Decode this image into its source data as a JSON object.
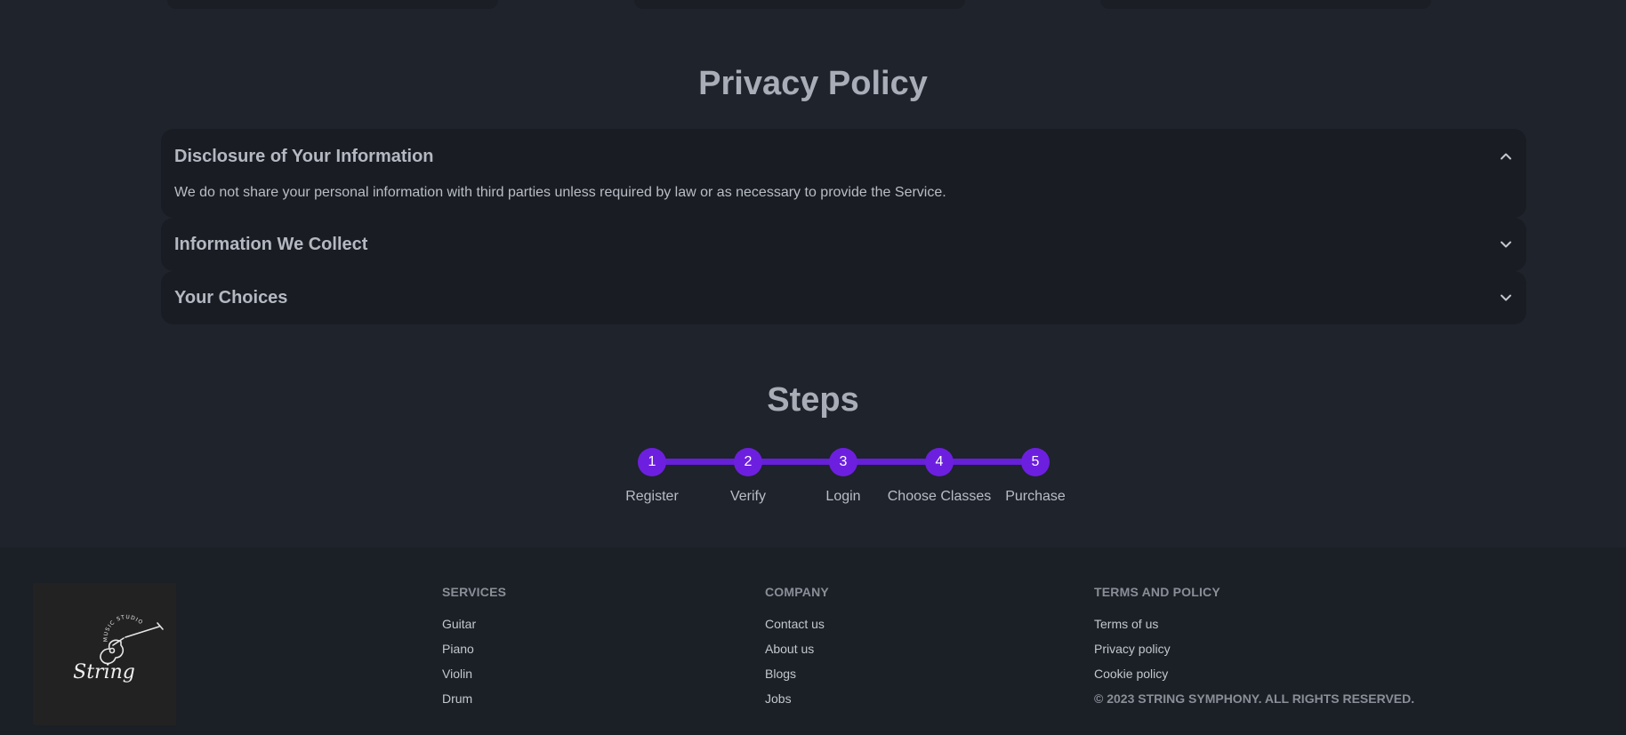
{
  "privacy": {
    "title": "Privacy Policy",
    "items": [
      {
        "title": "Disclosure of Your Information",
        "body": "We do not share your personal information with third parties unless required by law or as necessary to provide the Service.",
        "expanded": true,
        "icon": "chevron-up-icon"
      },
      {
        "title": "Information We Collect",
        "expanded": false,
        "icon": "chevron-down-icon"
      },
      {
        "title": "Your Choices",
        "expanded": false,
        "icon": "chevron-down-icon"
      }
    ]
  },
  "steps": {
    "title": "Steps",
    "accent": "#6d1fe0",
    "items": [
      {
        "number": "1",
        "label": "Register"
      },
      {
        "number": "2",
        "label": "Verify"
      },
      {
        "number": "3",
        "label": "Login"
      },
      {
        "number": "4",
        "label": "Choose Classes"
      },
      {
        "number": "5",
        "label": "Purchase"
      }
    ]
  },
  "footer": {
    "logo": {
      "title": "String",
      "subtitle": "MUSIC STUDIO",
      "icon": "guitar-icon"
    },
    "services": {
      "heading": "SERVICES",
      "links": [
        "Guitar",
        "Piano",
        "Violin",
        "Drum"
      ]
    },
    "company": {
      "heading": "COMPANY",
      "links": [
        "Contact us",
        "About us",
        "Blogs",
        "Jobs"
      ]
    },
    "terms": {
      "heading": "TERMS AND POLICY",
      "links": [
        "Terms of us",
        "Privacy policy",
        "Cookie policy"
      ]
    },
    "copyright": "© 2023 STRING SYMPHONY. ALL RIGHTS RESERVED."
  }
}
